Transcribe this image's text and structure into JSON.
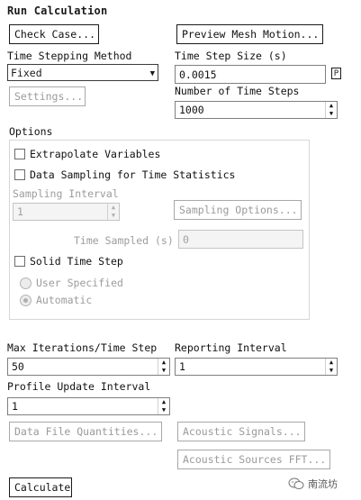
{
  "title": "Run Calculation",
  "buttons": {
    "check_case": "Check Case...",
    "preview_mesh_motion": "Preview Mesh Motion...",
    "settings": "Settings...",
    "sampling_options": "Sampling Options...",
    "data_file_quantities": "Data File Quantities...",
    "acoustic_signals": "Acoustic Signals...",
    "acoustic_sources_fft": "Acoustic Sources FFT...",
    "calculate": "Calculate"
  },
  "time_stepping": {
    "method_label": "Time Stepping Method",
    "method_value": "Fixed",
    "step_size_label": "Time Step Size (s)",
    "step_size_value": "0.0015",
    "param_button": "P",
    "num_steps_label": "Number of Time Steps",
    "num_steps_value": "1000"
  },
  "options": {
    "label": "Options",
    "extrapolate": "Extrapolate Variables",
    "data_sampling": "Data Sampling for Time Statistics",
    "sampling_interval_label": "Sampling Interval",
    "sampling_interval_value": "1",
    "time_sampled_label": "Time Sampled (s)",
    "time_sampled_value": "0",
    "solid_time_step": "Solid Time Step",
    "radio_user": "User Specified",
    "radio_auto": "Automatic"
  },
  "iterations": {
    "max_label": "Max Iterations/Time Step",
    "max_value": "50",
    "reporting_label": "Reporting Interval",
    "reporting_value": "1",
    "profile_label": "Profile Update Interval",
    "profile_value": "1"
  },
  "watermark": "南流坊"
}
